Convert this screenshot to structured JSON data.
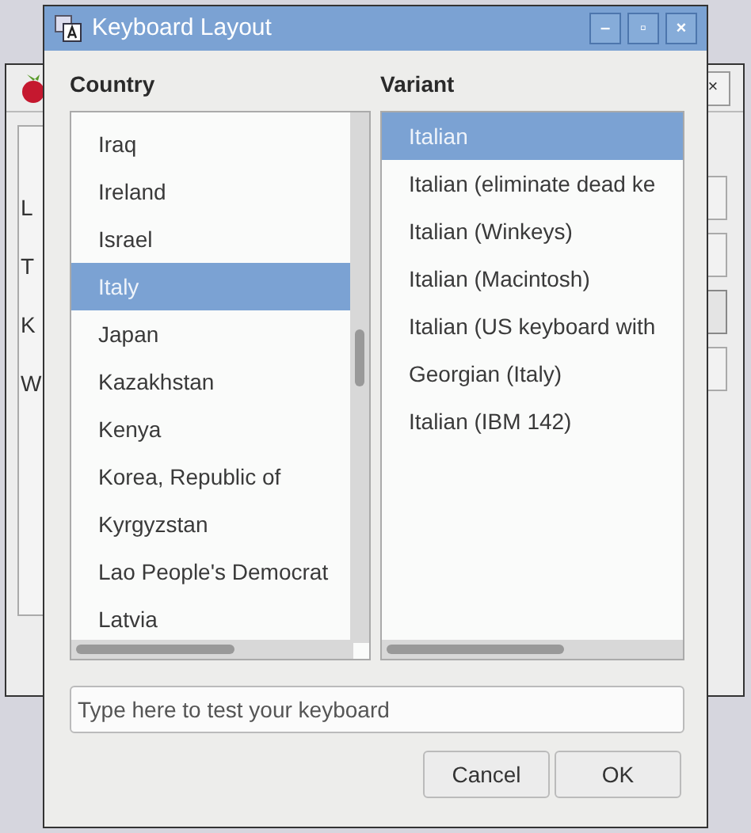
{
  "background_window": {
    "labels": [
      "L",
      "T",
      "K",
      "W"
    ],
    "close_button": "×"
  },
  "window": {
    "title": "Keyboard Layout",
    "controls": [
      "–",
      "▫",
      "×"
    ]
  },
  "country": {
    "heading": "Country",
    "items": [
      {
        "label": "Iraq",
        "selected": false
      },
      {
        "label": "Ireland",
        "selected": false
      },
      {
        "label": "Israel",
        "selected": false
      },
      {
        "label": "Italy",
        "selected": true
      },
      {
        "label": "Japan",
        "selected": false
      },
      {
        "label": "Kazakhstan",
        "selected": false
      },
      {
        "label": "Kenya",
        "selected": false
      },
      {
        "label": "Korea, Republic of",
        "selected": false
      },
      {
        "label": "Kyrgyzstan",
        "selected": false
      },
      {
        "label": "Lao People's Democrat",
        "selected": false
      },
      {
        "label": "Latvia",
        "selected": false
      }
    ]
  },
  "variant": {
    "heading": "Variant",
    "items": [
      {
        "label": "Italian",
        "selected": true
      },
      {
        "label": "Italian (eliminate dead ke",
        "selected": false
      },
      {
        "label": "Italian (Winkeys)",
        "selected": false
      },
      {
        "label": "Italian (Macintosh)",
        "selected": false
      },
      {
        "label": "Italian (US keyboard with",
        "selected": false
      },
      {
        "label": "Georgian (Italy)",
        "selected": false
      },
      {
        "label": "Italian (IBM 142)",
        "selected": false
      }
    ]
  },
  "test_field": {
    "placeholder": "Type here to test your keyboard"
  },
  "buttons": [
    "Cancel",
    "OK"
  ]
}
